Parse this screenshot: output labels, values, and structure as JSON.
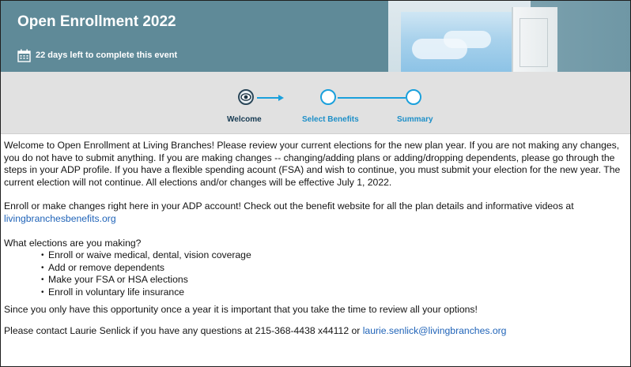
{
  "banner": {
    "title": "Open Enrollment 2022",
    "days_left": "22 days left to complete this event",
    "icon": "calendar-icon"
  },
  "stepper": {
    "steps": [
      {
        "label": "Welcome",
        "state": "current"
      },
      {
        "label": "Select Benefits",
        "state": "upcoming"
      },
      {
        "label": "Summary",
        "state": "upcoming"
      }
    ],
    "colors": {
      "accent": "#1aa0dc",
      "current": "#163a52",
      "bar_bg": "#e1e1e1"
    }
  },
  "content": {
    "intro": "Welcome to Open Enrollment at Living Branches!  Please review your current elections for the new plan year. If you are not making any changes, you do not have to submit anything. If you are making changes -- changing/adding plans or adding/dropping dependents, please go through the steps in your ADP profile. If you have a flexible spending acount (FSA) and wish to continue, you must submit your election for the new year.  The current election will not continue.  All elections and/or changes will be effective July 1, 2022.",
    "enroll_text": "Enroll or make changes right here in your ADP account!  Check out the benefit website for all the plan details and informative videos at ",
    "enroll_link": "livingbranchesbenefits.org",
    "question": "What elections are you making?",
    "bullets": [
      "Enroll or waive medical, dental, vision coverage",
      "Add or remove dependents",
      "Make your FSA or HSA elections",
      "Enroll in voluntary life insurance"
    ],
    "reminder": "Since you only have this opportunity once a year it is important that you take the time to review all your options!",
    "contact_text": "Please contact Laurie Senlick if you have any questions at 215-368-4438 x44112 or ",
    "contact_email": "laurie.senlick@livingbranches.org"
  }
}
